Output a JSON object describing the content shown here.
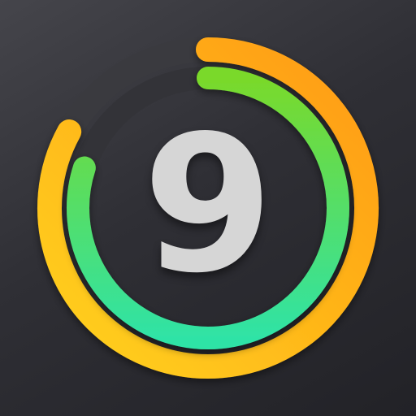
{
  "icon": {
    "digit": "9",
    "outer_ring_progress": 0.83,
    "inner_ring_progress": 0.8,
    "colors": {
      "background": "#2f2f35",
      "track": "#3b3b40",
      "outer_ring_start": "#ffd21f",
      "outer_ring_end": "#ff9a12",
      "inner_ring_start": "#7ad92a",
      "inner_ring_end": "#2fe3a6",
      "digit": "#d6d6d6"
    }
  }
}
